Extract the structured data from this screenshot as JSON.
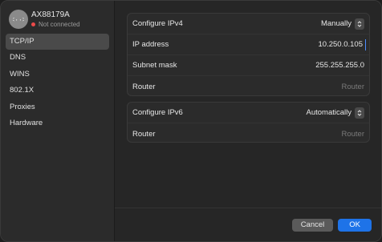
{
  "sidebar": {
    "device_name": "AX88179A",
    "device_status": "Not connected",
    "items": [
      {
        "label": "TCP/IP",
        "active": true
      },
      {
        "label": "DNS"
      },
      {
        "label": "WINS"
      },
      {
        "label": "802.1X"
      },
      {
        "label": "Proxies"
      },
      {
        "label": "Hardware"
      }
    ]
  },
  "ipv4": {
    "configure_label": "Configure IPv4",
    "configure_value": "Manually",
    "ip_label": "IP address",
    "ip_value": "10.250.0.105",
    "subnet_label": "Subnet mask",
    "subnet_value": "255.255.255.0",
    "router_label": "Router",
    "router_placeholder": "Router"
  },
  "ipv6": {
    "configure_label": "Configure IPv6",
    "configure_value": "Automatically",
    "router_label": "Router",
    "router_placeholder": "Router"
  },
  "footer": {
    "cancel_label": "Cancel",
    "ok_label": "OK"
  },
  "colors": {
    "accent": "#1e73e8",
    "status_dot": "#ec4a4a"
  }
}
